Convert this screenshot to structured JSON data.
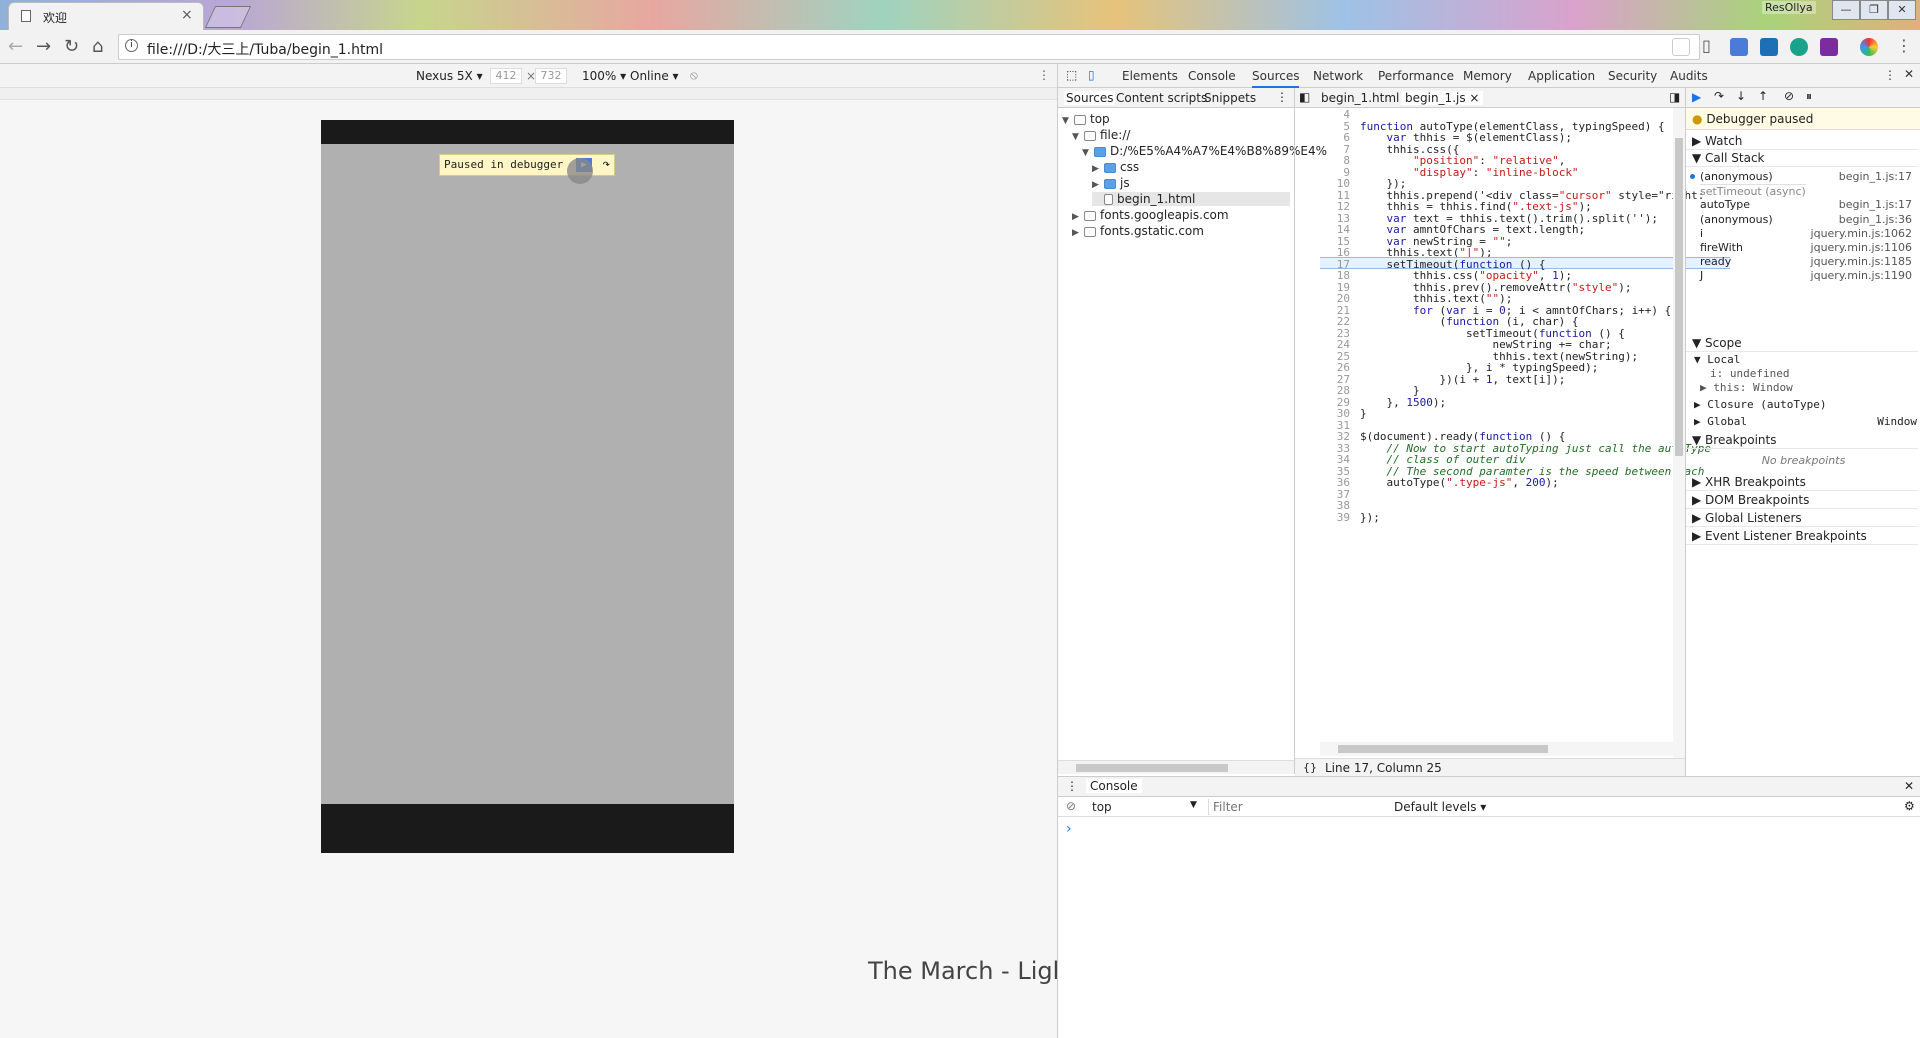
{
  "browser": {
    "tab_title": "欢迎",
    "tab_close": "×",
    "title_user": "ResOllya",
    "window_buttons": [
      "—",
      "❐",
      "✕"
    ],
    "url": "file:///D:/大三上/Tuba/begin_1.html"
  },
  "device_toolbar": {
    "device": "Nexus 5X ▾",
    "width": "412",
    "times": "×",
    "height": "732",
    "zoom": "100% ▾",
    "network": "Online ▾"
  },
  "page": {
    "paused_text": "Paused in debugger"
  },
  "devtools": {
    "tabs": [
      "Elements",
      "Console",
      "Sources",
      "Network",
      "Performance",
      "Memory",
      "Application",
      "Security",
      "Audits"
    ],
    "navigator_tabs": [
      "Sources",
      "Content scripts",
      "Snippets"
    ],
    "editor_tabs": [
      "begin_1.html",
      "begin_1.js"
    ],
    "tree": [
      {
        "text": "top",
        "indent": 0,
        "arrow": "▼"
      },
      {
        "text": "file://",
        "indent": 1,
        "arrow": "▼"
      },
      {
        "text": "D:/%E5%A4%A7%E4%B8%89%E4%",
        "indent": 2,
        "arrow": "▼"
      },
      {
        "text": "css",
        "indent": 3,
        "arrow": "▶"
      },
      {
        "text": "js",
        "indent": 3,
        "arrow": "▶"
      },
      {
        "text": "begin_1.html",
        "indent": 3,
        "arrow": ""
      },
      {
        "text": "fonts.googleapis.com",
        "indent": 1,
        "arrow": "▶"
      },
      {
        "text": "fonts.gstatic.com",
        "indent": 1,
        "arrow": "▶"
      }
    ],
    "code": [
      {
        "n": "4",
        "t": ""
      },
      {
        "n": "5",
        "t": "function autoType(elementClass, typingSpeed) {"
      },
      {
        "n": "6",
        "t": "    var thhis = $(elementClass);"
      },
      {
        "n": "7",
        "t": "    thhis.css({"
      },
      {
        "n": "8",
        "t": "        \"position\": \"relative\","
      },
      {
        "n": "9",
        "t": "        \"display\": \"inline-block\""
      },
      {
        "n": "10",
        "t": "    });"
      },
      {
        "n": "11",
        "t": "    thhis.prepend('<div class=\"cursor\" style=\"right:"
      },
      {
        "n": "12",
        "t": "    thhis = thhis.find(\".text-js\");"
      },
      {
        "n": "13",
        "t": "    var text = thhis.text().trim().split('');"
      },
      {
        "n": "14",
        "t": "    var amntOfChars = text.length;"
      },
      {
        "n": "15",
        "t": "    var newString = \"\";"
      },
      {
        "n": "16",
        "t": "    thhis.text(\"|\");"
      },
      {
        "n": "17",
        "t": "    setTimeout(function () {"
      },
      {
        "n": "18",
        "t": "        thhis.css(\"opacity\", 1);"
      },
      {
        "n": "19",
        "t": "        thhis.prev().removeAttr(\"style\");"
      },
      {
        "n": "20",
        "t": "        thhis.text(\"\");"
      },
      {
        "n": "21",
        "t": "        for (var i = 0; i < amntOfChars; i++) {"
      },
      {
        "n": "22",
        "t": "            (function (i, char) {"
      },
      {
        "n": "23",
        "t": "                setTimeout(function () {"
      },
      {
        "n": "24",
        "t": "                    newString += char;"
      },
      {
        "n": "25",
        "t": "                    thhis.text(newString);"
      },
      {
        "n": "26",
        "t": "                }, i * typingSpeed);"
      },
      {
        "n": "27",
        "t": "            })(i + 1, text[i]);"
      },
      {
        "n": "28",
        "t": "        }"
      },
      {
        "n": "29",
        "t": "    }, 1500);"
      },
      {
        "n": "30",
        "t": "}"
      },
      {
        "n": "31",
        "t": ""
      },
      {
        "n": "32",
        "t": "$(document).ready(function () {"
      },
      {
        "n": "33",
        "t": "    // Now to start autoTyping just call the autoType"
      },
      {
        "n": "34",
        "t": "    // class of outer div"
      },
      {
        "n": "35",
        "t": "    // The second paramter is the speed between each"
      },
      {
        "n": "36",
        "t": "    autoType(\".type-js\", 200);"
      },
      {
        "n": "37",
        "t": ""
      },
      {
        "n": "38",
        "t": ""
      },
      {
        "n": "39",
        "t": "});"
      }
    ],
    "status": "Line 17, Column 25",
    "debugger": {
      "paused": "Debugger paused",
      "watch": "Watch",
      "call_stack": "Call Stack",
      "stack": [
        {
          "name": "(anonymous)",
          "loc": "begin_1.js:17"
        },
        {
          "name": "setTimeout (async)",
          "loc": ""
        },
        {
          "name": "autoType",
          "loc": "begin_1.js:17"
        },
        {
          "name": "(anonymous)",
          "loc": "begin_1.js:36"
        },
        {
          "name": "i",
          "loc": "jquery.min.js:1062"
        },
        {
          "name": "fireWith",
          "loc": "jquery.min.js:1106"
        },
        {
          "name": "ready",
          "loc": "jquery.min.js:1185"
        },
        {
          "name": "J",
          "loc": "jquery.min.js:1190"
        }
      ],
      "scope": "Scope",
      "local": "Local",
      "local_i": "i: undefined",
      "local_this": "this: Window",
      "closure": "Closure (autoType)",
      "global": "Global",
      "global_val": "Window",
      "breakpoints": "Breakpoints",
      "no_breakpoints": "No breakpoints",
      "xhr": "XHR Breakpoints",
      "dom": "DOM Breakpoints",
      "listeners": "Global Listeners",
      "event": "Event Listener Breakpoints"
    },
    "console": {
      "tab": "Console",
      "context": "top",
      "filter_placeholder": "Filter",
      "levels": "Default levels ▾",
      "prompt": "›"
    }
  },
  "caption": "The March - Lights & Motion",
  "colors": {
    "accent": "#1a73e8",
    "highlight_line": "#e8f0fe"
  }
}
